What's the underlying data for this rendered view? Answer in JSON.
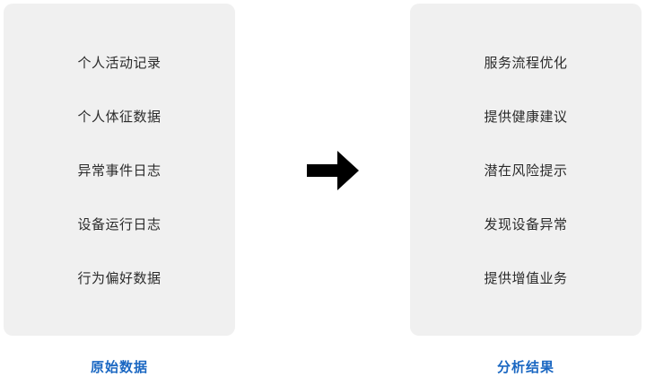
{
  "source_panel": {
    "items": [
      "个人活动记录",
      "个人体征数据",
      "异常事件日志",
      "设备运行日志",
      "行为偏好数据"
    ],
    "caption": "原始数据"
  },
  "result_panel": {
    "items": [
      "服务流程优化",
      "提供健康建议",
      "潜在风险提示",
      "发现设备异常",
      "提供增值业务"
    ],
    "caption": "分析结果"
  },
  "colors": {
    "panel_bg": "#f0f0f0",
    "caption": "#1a67c2",
    "arrow": "#000000"
  },
  "icons": {
    "flow": "right-arrow-icon"
  }
}
